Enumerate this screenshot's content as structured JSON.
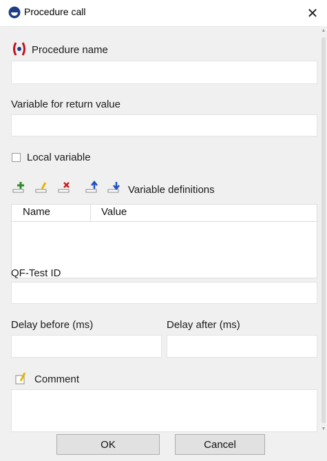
{
  "window": {
    "title": "Procedure call"
  },
  "fields": {
    "procedure_name_label": "Procedure name",
    "return_variable_label": "Variable for return value",
    "local_variable_label": "Local variable",
    "variable_definitions_label": "Variable definitions",
    "qftest_id_label": "QF-Test ID",
    "delay_before_label": "Delay before (ms)",
    "delay_after_label": "Delay after (ms)",
    "comment_label": "Comment"
  },
  "table": {
    "columns": [
      "Name",
      "Value"
    ]
  },
  "buttons": {
    "ok": "OK",
    "cancel": "Cancel"
  },
  "icons": {
    "app": "qftest-app-icon",
    "procedure": "procedure-call-icon",
    "add_row": "add-row-icon",
    "edit_row": "edit-row-icon",
    "delete_row": "delete-row-icon",
    "move_up": "move-up-icon",
    "move_down": "move-down-icon",
    "comment": "comment-icon",
    "close": "close-icon"
  },
  "colors": {
    "accent_red": "#c1121f",
    "icon_blue": "#1f3c88",
    "green": "#2e8b2e",
    "yellow": "#e3b800"
  }
}
